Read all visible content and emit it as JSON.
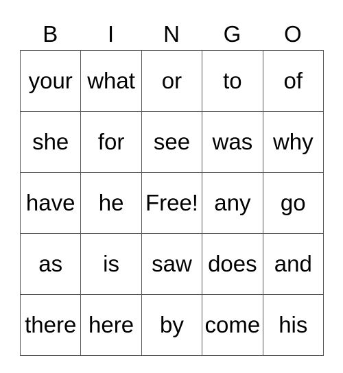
{
  "header": [
    "B",
    "I",
    "N",
    "G",
    "O"
  ],
  "rows": [
    [
      "your",
      "what",
      "or",
      "to",
      "of"
    ],
    [
      "she",
      "for",
      "see",
      "was",
      "why"
    ],
    [
      "have",
      "he",
      "Free!",
      "any",
      "go"
    ],
    [
      "as",
      "is",
      "saw",
      "does",
      "and"
    ],
    [
      "there",
      "here",
      "by",
      "come",
      "his"
    ]
  ]
}
